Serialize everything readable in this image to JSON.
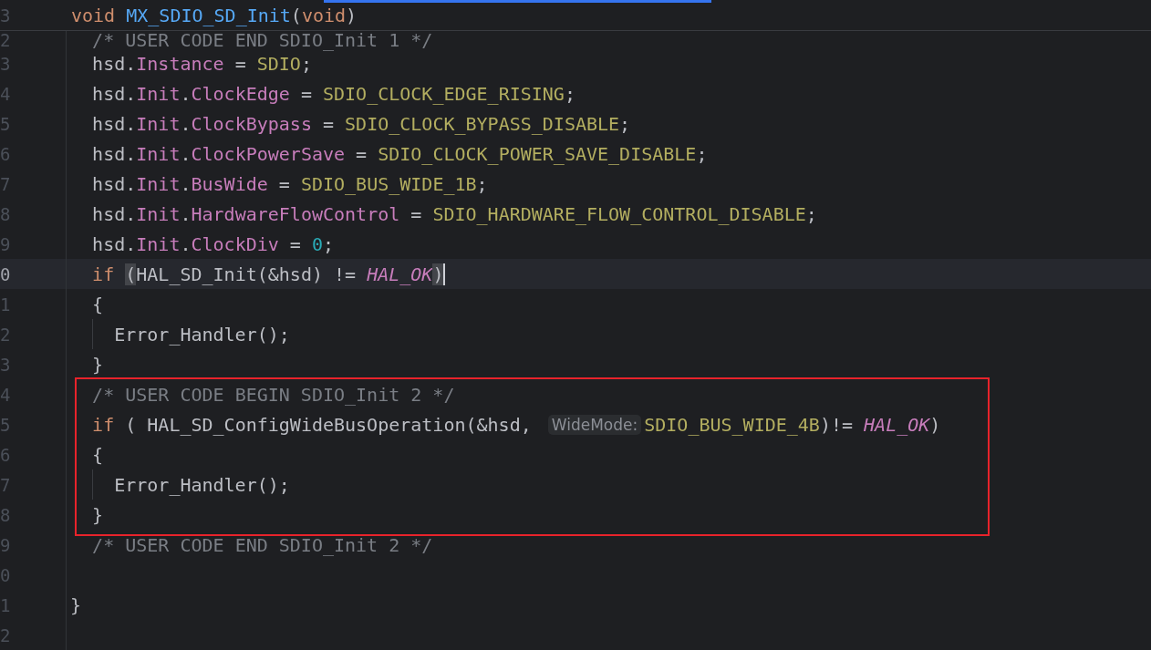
{
  "sticky_header": {
    "line_number": "3",
    "tokens": [
      {
        "text": "void ",
        "kind": "keyword"
      },
      {
        "text": "MX_SDIO_SD_Init",
        "kind": "function"
      },
      {
        "text": "(",
        "kind": "plain"
      },
      {
        "text": "void",
        "kind": "keyword"
      },
      {
        "text": ")",
        "kind": "plain"
      }
    ]
  },
  "lines": [
    {
      "number": "2",
      "current": false,
      "tokens": [
        {
          "text": "  /* USER CODE END SDIO_Init 1 */",
          "kind": "comment"
        }
      ]
    },
    {
      "number": "3",
      "current": false,
      "tokens": [
        {
          "text": "  hsd.",
          "kind": "plain"
        },
        {
          "text": "Instance",
          "kind": "field"
        },
        {
          "text": " = ",
          "kind": "plain"
        },
        {
          "text": "SDIO",
          "kind": "macro"
        },
        {
          "text": ";",
          "kind": "plain"
        }
      ]
    },
    {
      "number": "4",
      "current": false,
      "tokens": [
        {
          "text": "  hsd.",
          "kind": "plain"
        },
        {
          "text": "Init",
          "kind": "field"
        },
        {
          "text": ".",
          "kind": "plain"
        },
        {
          "text": "ClockEdge",
          "kind": "field"
        },
        {
          "text": " = ",
          "kind": "plain"
        },
        {
          "text": "SDIO_CLOCK_EDGE_RISING",
          "kind": "macro"
        },
        {
          "text": ";",
          "kind": "plain"
        }
      ]
    },
    {
      "number": "5",
      "current": false,
      "tokens": [
        {
          "text": "  hsd.",
          "kind": "plain"
        },
        {
          "text": "Init",
          "kind": "field"
        },
        {
          "text": ".",
          "kind": "plain"
        },
        {
          "text": "ClockBypass",
          "kind": "field"
        },
        {
          "text": " = ",
          "kind": "plain"
        },
        {
          "text": "SDIO_CLOCK_BYPASS_DISABLE",
          "kind": "macro"
        },
        {
          "text": ";",
          "kind": "plain"
        }
      ]
    },
    {
      "number": "6",
      "current": false,
      "tokens": [
        {
          "text": "  hsd.",
          "kind": "plain"
        },
        {
          "text": "Init",
          "kind": "field"
        },
        {
          "text": ".",
          "kind": "plain"
        },
        {
          "text": "ClockPowerSave",
          "kind": "field"
        },
        {
          "text": " = ",
          "kind": "plain"
        },
        {
          "text": "SDIO_CLOCK_POWER_SAVE_DISABLE",
          "kind": "macro"
        },
        {
          "text": ";",
          "kind": "plain"
        }
      ]
    },
    {
      "number": "7",
      "current": false,
      "tokens": [
        {
          "text": "  hsd.",
          "kind": "plain"
        },
        {
          "text": "Init",
          "kind": "field"
        },
        {
          "text": ".",
          "kind": "plain"
        },
        {
          "text": "BusWide",
          "kind": "field"
        },
        {
          "text": " = ",
          "kind": "plain"
        },
        {
          "text": "SDIO_BUS_WIDE_1B",
          "kind": "macro"
        },
        {
          "text": ";",
          "kind": "plain"
        }
      ]
    },
    {
      "number": "8",
      "current": false,
      "tokens": [
        {
          "text": "  hsd.",
          "kind": "plain"
        },
        {
          "text": "Init",
          "kind": "field"
        },
        {
          "text": ".",
          "kind": "plain"
        },
        {
          "text": "HardwareFlowControl",
          "kind": "field"
        },
        {
          "text": " = ",
          "kind": "plain"
        },
        {
          "text": "SDIO_HARDWARE_FLOW_CONTROL_DISABLE",
          "kind": "macro"
        },
        {
          "text": ";",
          "kind": "plain"
        }
      ]
    },
    {
      "number": "9",
      "current": false,
      "tokens": [
        {
          "text": "  hsd.",
          "kind": "plain"
        },
        {
          "text": "Init",
          "kind": "field"
        },
        {
          "text": ".",
          "kind": "plain"
        },
        {
          "text": "ClockDiv",
          "kind": "field"
        },
        {
          "text": " = ",
          "kind": "plain"
        },
        {
          "text": "0",
          "kind": "number"
        },
        {
          "text": ";",
          "kind": "plain"
        }
      ]
    },
    {
      "number": "0",
      "current": true,
      "caret": true,
      "tokens": [
        {
          "text": "  if ",
          "kind": "keyword"
        },
        {
          "text": "(",
          "kind": "matched_bracket"
        },
        {
          "text": "HAL_SD_Init(&hsd) != ",
          "kind": "plain"
        },
        {
          "text": "HAL_OK",
          "kind": "enum"
        },
        {
          "text": ")",
          "kind": "matched_bracket"
        }
      ]
    },
    {
      "number": "1",
      "current": false,
      "tokens": [
        {
          "text": "  {",
          "kind": "plain"
        }
      ]
    },
    {
      "number": "2",
      "current": false,
      "guide": true,
      "tokens": [
        {
          "text": "    Error_Handler();",
          "kind": "plain"
        }
      ]
    },
    {
      "number": "3",
      "current": false,
      "tokens": [
        {
          "text": "  }",
          "kind": "plain"
        }
      ]
    },
    {
      "number": "4",
      "current": false,
      "tokens": [
        {
          "text": "  /* USER CODE BEGIN SDIO_Init 2 */",
          "kind": "comment"
        }
      ]
    },
    {
      "number": "5",
      "current": false,
      "tokens": [
        {
          "text": "  if ",
          "kind": "keyword"
        },
        {
          "text": "( HAL_SD_ConfigWideBusOperation(&hsd, ",
          "kind": "plain"
        },
        {
          "text": "WideMode:",
          "kind": "hint"
        },
        {
          "text": "SDIO_BUS_WIDE_4B",
          "kind": "macro"
        },
        {
          "text": ")!= ",
          "kind": "plain"
        },
        {
          "text": "HAL_OK",
          "kind": "enum"
        },
        {
          "text": ")",
          "kind": "plain"
        }
      ]
    },
    {
      "number": "6",
      "current": false,
      "tokens": [
        {
          "text": "  {",
          "kind": "plain"
        }
      ]
    },
    {
      "number": "7",
      "current": false,
      "guide": true,
      "tokens": [
        {
          "text": "    Error_Handler();",
          "kind": "plain"
        }
      ]
    },
    {
      "number": "8",
      "current": false,
      "tokens": [
        {
          "text": "  }",
          "kind": "plain"
        }
      ]
    },
    {
      "number": "9",
      "current": false,
      "tokens": [
        {
          "text": "  /* USER CODE END SDIO_Init 2 */",
          "kind": "comment"
        }
      ]
    },
    {
      "number": "0",
      "current": false
    },
    {
      "number": "1",
      "current": false,
      "tokens": [
        {
          "text": "}",
          "kind": "plain"
        }
      ]
    },
    {
      "number": "2",
      "current": false
    }
  ]
}
